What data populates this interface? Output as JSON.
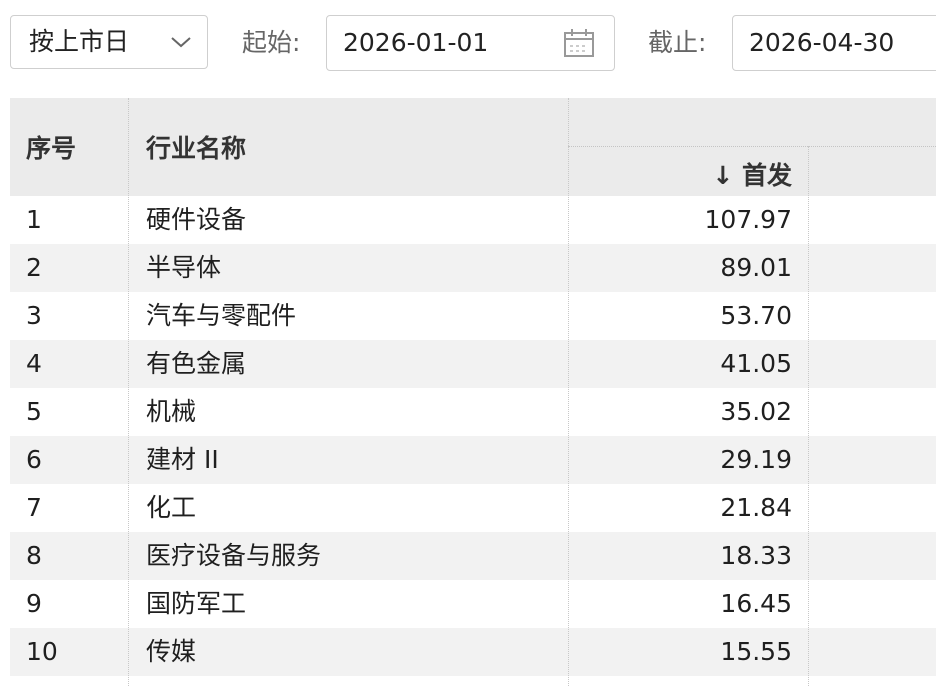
{
  "filters": {
    "mode_select": "按上市日",
    "start_label": "起始:",
    "start_date": "2026-01-01",
    "end_label": "截止:",
    "end_date": "2026-04-30"
  },
  "table": {
    "columns": {
      "index": "序号",
      "name": "行业名称",
      "sort_column": "↓ 首发"
    },
    "rows": [
      {
        "index": "1",
        "name": "硬件设备",
        "value": "107.97"
      },
      {
        "index": "2",
        "name": "半导体",
        "value": "89.01"
      },
      {
        "index": "3",
        "name": "汽车与零配件",
        "value": "53.70"
      },
      {
        "index": "4",
        "name": "有色金属",
        "value": "41.05"
      },
      {
        "index": "5",
        "name": "机械",
        "value": "35.02"
      },
      {
        "index": "6",
        "name": "建材 II",
        "value": "29.19"
      },
      {
        "index": "7",
        "name": "化工",
        "value": "21.84"
      },
      {
        "index": "8",
        "name": "医疗设备与服务",
        "value": "18.33"
      },
      {
        "index": "9",
        "name": "国防军工",
        "value": "16.45"
      },
      {
        "index": "10",
        "name": "传媒",
        "value": "15.55"
      }
    ]
  },
  "icons": {
    "select_caret": "chevron-down-icon",
    "date_picker": "calendar-icon"
  },
  "colors": {
    "header_bg": "#ebebeb",
    "row_alt_bg": "#f2f2f2",
    "border": "#cfcfcf"
  }
}
